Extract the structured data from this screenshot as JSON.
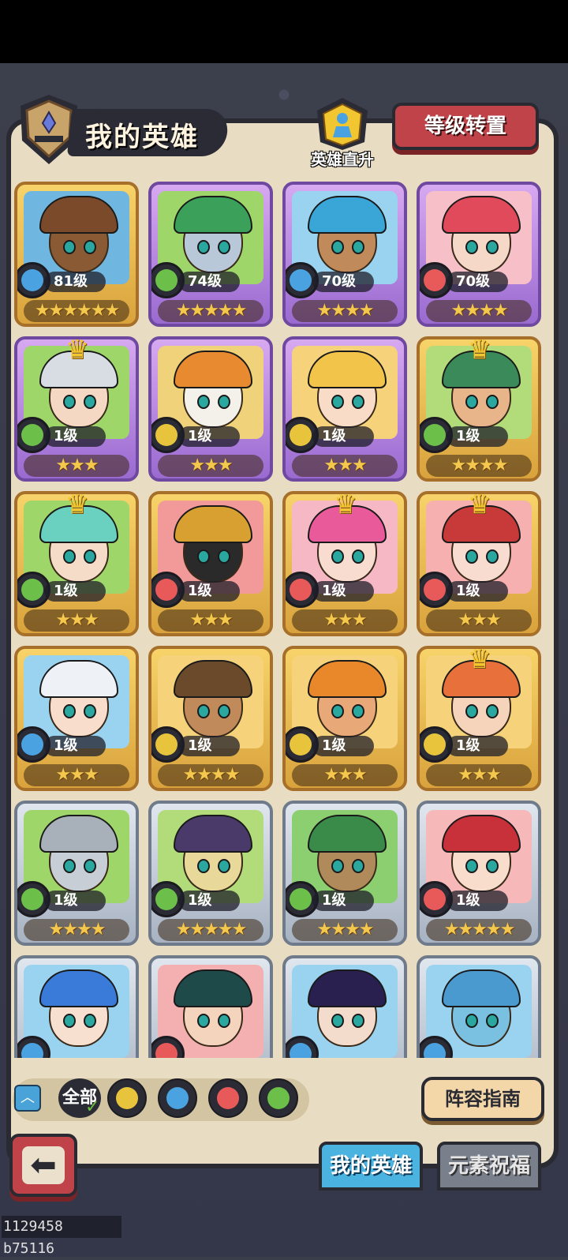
{
  "header": {
    "title": "我的英雄",
    "direct_upgrade_label": "英雄直升",
    "level_reset_label": "等级转置"
  },
  "elements": {
    "water": "#4aa3e0",
    "wind": "#6cc04a",
    "fire": "#e85a5a",
    "earth": "#e8c43c"
  },
  "heroes": [
    {
      "level": "81级",
      "stars": "★★★★★★",
      "element": "water",
      "frame": "gold",
      "crown": false,
      "bg": "#6fb7e0",
      "hair": "#7a4a2a",
      "skin": "#8a5a34"
    },
    {
      "level": "74级",
      "stars": "★★★★★",
      "element": "wind",
      "frame": "purple",
      "crown": false,
      "bg": "#9fd66a",
      "hair": "#3aa05a",
      "skin": "#b8c8d8"
    },
    {
      "level": "70级",
      "stars": "★★★★",
      "element": "water",
      "frame": "purple",
      "crown": false,
      "bg": "#9ad3f0",
      "hair": "#3aa6d8",
      "skin": "#c08a5a"
    },
    {
      "level": "70级",
      "stars": "★★★★",
      "element": "fire",
      "frame": "purple",
      "crown": false,
      "bg": "#f7c0c8",
      "hair": "#e04a5a",
      "skin": "#f6d8c8"
    },
    {
      "level": "1级",
      "stars": "★★★",
      "element": "wind",
      "frame": "purple",
      "crown": true,
      "bg": "#9fd66a",
      "hair": "#d8dde4",
      "skin": "#f4d8c4"
    },
    {
      "level": "1级",
      "stars": "★★★",
      "element": "earth",
      "frame": "purple",
      "crown": false,
      "bg": "#f0d27a",
      "hair": "#e88a30",
      "skin": "#f4f0ea"
    },
    {
      "level": "1级",
      "stars": "★★★",
      "element": "earth",
      "frame": "purple",
      "crown": false,
      "bg": "#f6d37a",
      "hair": "#f2c44a",
      "skin": "#f8dcc8"
    },
    {
      "level": "1级",
      "stars": "★★★★",
      "element": "wind",
      "frame": "gold",
      "crown": true,
      "bg": "#b2dc7a",
      "hair": "#3a8a5a",
      "skin": "#e8b48a"
    },
    {
      "level": "1级",
      "stars": "★★★",
      "element": "wind",
      "frame": "gold",
      "crown": true,
      "bg": "#9fd66a",
      "hair": "#6ad0c0",
      "skin": "#f4dcc8"
    },
    {
      "level": "1级",
      "stars": "★★★",
      "element": "fire",
      "frame": "gold",
      "crown": false,
      "bg": "#f29a9a",
      "hair": "#d8a030",
      "skin": "#2a2a2a"
    },
    {
      "level": "1级",
      "stars": "★★★",
      "element": "fire",
      "frame": "gold",
      "crown": true,
      "bg": "#f6b8c4",
      "hair": "#e85a9a",
      "skin": "#f8dcd0"
    },
    {
      "level": "1级",
      "stars": "★★★",
      "element": "fire",
      "frame": "gold",
      "crown": true,
      "bg": "#f6b0b0",
      "hair": "#c83a3a",
      "skin": "#f8dcd0"
    },
    {
      "level": "1级",
      "stars": "★★★",
      "element": "water",
      "frame": "gold",
      "crown": false,
      "bg": "#9ad3f0",
      "hair": "#eef2f6",
      "skin": "#f8dccc"
    },
    {
      "level": "1级",
      "stars": "★★★★",
      "element": "earth",
      "frame": "gold",
      "crown": false,
      "bg": "#f6d37a",
      "hair": "#6a4a2a",
      "skin": "#c08a5a"
    },
    {
      "level": "1级",
      "stars": "★★★",
      "element": "earth",
      "frame": "gold",
      "crown": false,
      "bg": "#f6d37a",
      "hair": "#e8882a",
      "skin": "#e8a878"
    },
    {
      "level": "1级",
      "stars": "★★★",
      "element": "earth",
      "frame": "gold",
      "crown": true,
      "bg": "#f6d37a",
      "hair": "#e8703a",
      "skin": "#f6d4bc"
    },
    {
      "level": "1级",
      "stars": "★★★★",
      "element": "wind",
      "frame": "silver",
      "crown": false,
      "bg": "#9fd66a",
      "hair": "#a8b0ba",
      "skin": "#c8ced6"
    },
    {
      "level": "1级",
      "stars": "★★★★★",
      "element": "wind",
      "frame": "silver",
      "crown": false,
      "bg": "#b2dc7a",
      "hair": "#4a3a6a",
      "skin": "#e8d89a"
    },
    {
      "level": "1级",
      "stars": "★★★★",
      "element": "wind",
      "frame": "silver",
      "crown": false,
      "bg": "#8ccf70",
      "hair": "#3a8a4a",
      "skin": "#b08a5a"
    },
    {
      "level": "1级",
      "stars": "★★★★★",
      "element": "fire",
      "frame": "silver",
      "crown": false,
      "bg": "#f6b8b8",
      "hair": "#c8303a",
      "skin": "#f8dccc"
    },
    {
      "level": "",
      "stars": "",
      "element": "water",
      "frame": "silver",
      "crown": false,
      "bg": "#9ad3f0",
      "hair": "#3a7ad8",
      "skin": "#f8e0d0"
    },
    {
      "level": "",
      "stars": "",
      "element": "fire",
      "frame": "silver",
      "crown": false,
      "bg": "#f4b0b0",
      "hair": "#1e4a4a",
      "skin": "#f4d4bc"
    },
    {
      "level": "",
      "stars": "",
      "element": "water",
      "frame": "silver",
      "crown": false,
      "bg": "#9ad3f0",
      "hair": "#2a2050",
      "skin": "#f4dccc"
    },
    {
      "level": "",
      "stars": "",
      "element": "water",
      "frame": "silver",
      "crown": false,
      "bg": "#9ad3f0",
      "hair": "#4a9ad0",
      "skin": "#7ac0e0"
    }
  ],
  "filters": {
    "all_label": "全部",
    "order": [
      "earth",
      "water",
      "fire",
      "wind"
    ]
  },
  "lineup_guide_label": "阵容指南",
  "tabs": {
    "my_heroes": "我的英雄",
    "element_blessing": "元素祝福"
  },
  "footer_id": "1129458 b75116"
}
